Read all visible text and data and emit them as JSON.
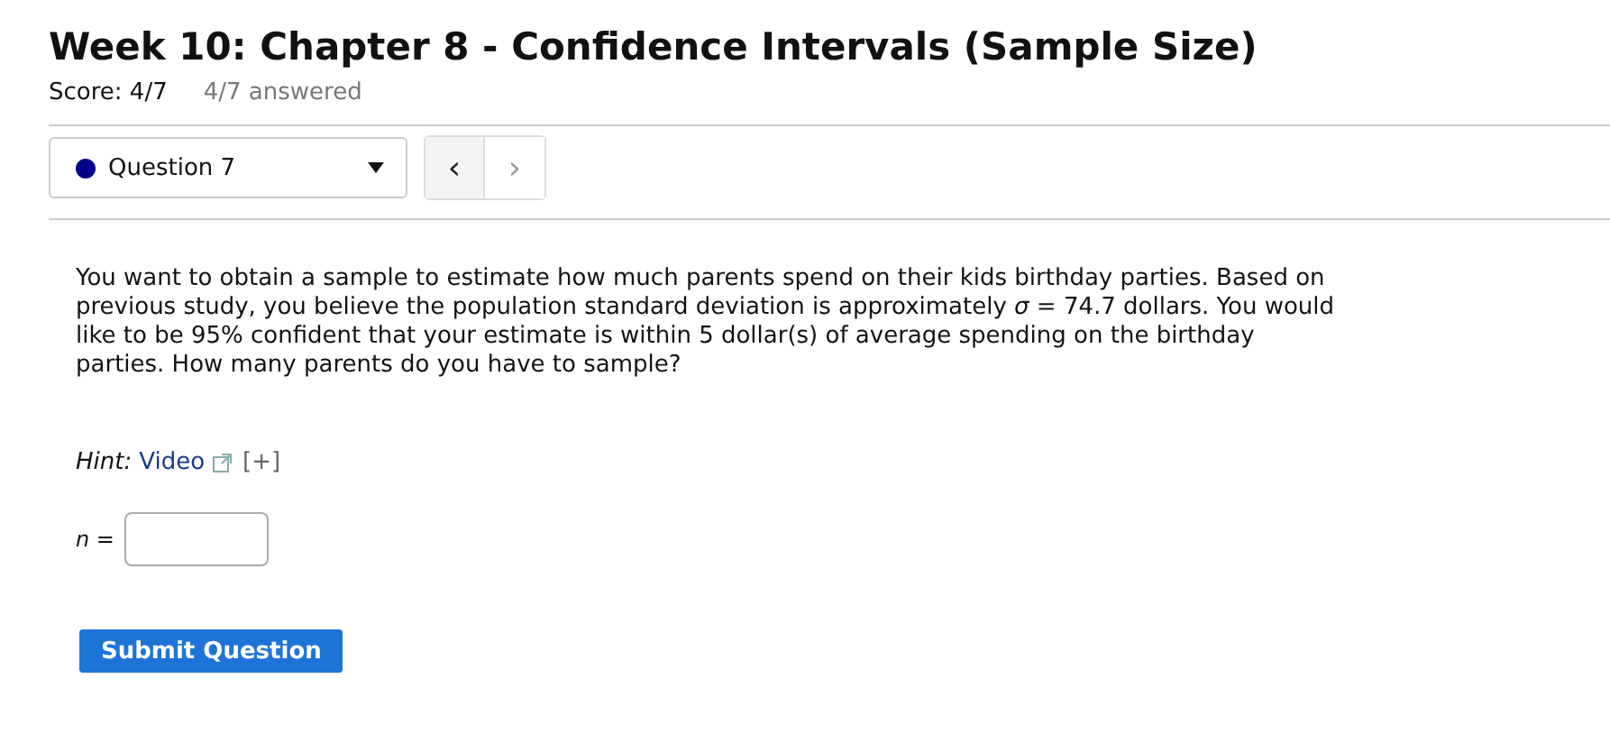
{
  "header": {
    "title": "Week 10: Chapter 8 - Confidence Intervals (Sample Size)",
    "score": "Score: 4/7",
    "answered": "4/7 answered"
  },
  "question_nav": {
    "dropdown_label": "Question 7",
    "prev": {
      "label": "‹",
      "disabled": false
    },
    "next": {
      "label": "›",
      "disabled": true
    }
  },
  "question": {
    "text": "You want to obtain a sample to estimate how much parents spend on their kids birthday parties. Based on previous study, you believe the population standard deviation is approximately *σ* = 74.7 dollars. You would like to be 95% confident that your estimate is within 5 dollar(s) of average spending on the birthday parties. How many parents do you have to sample?"
  },
  "hint": {
    "label": "Hint:",
    "link": "Video",
    "expand": "[+]"
  },
  "answer": {
    "label": "n ="
  },
  "submit_button": "Submit Question"
}
